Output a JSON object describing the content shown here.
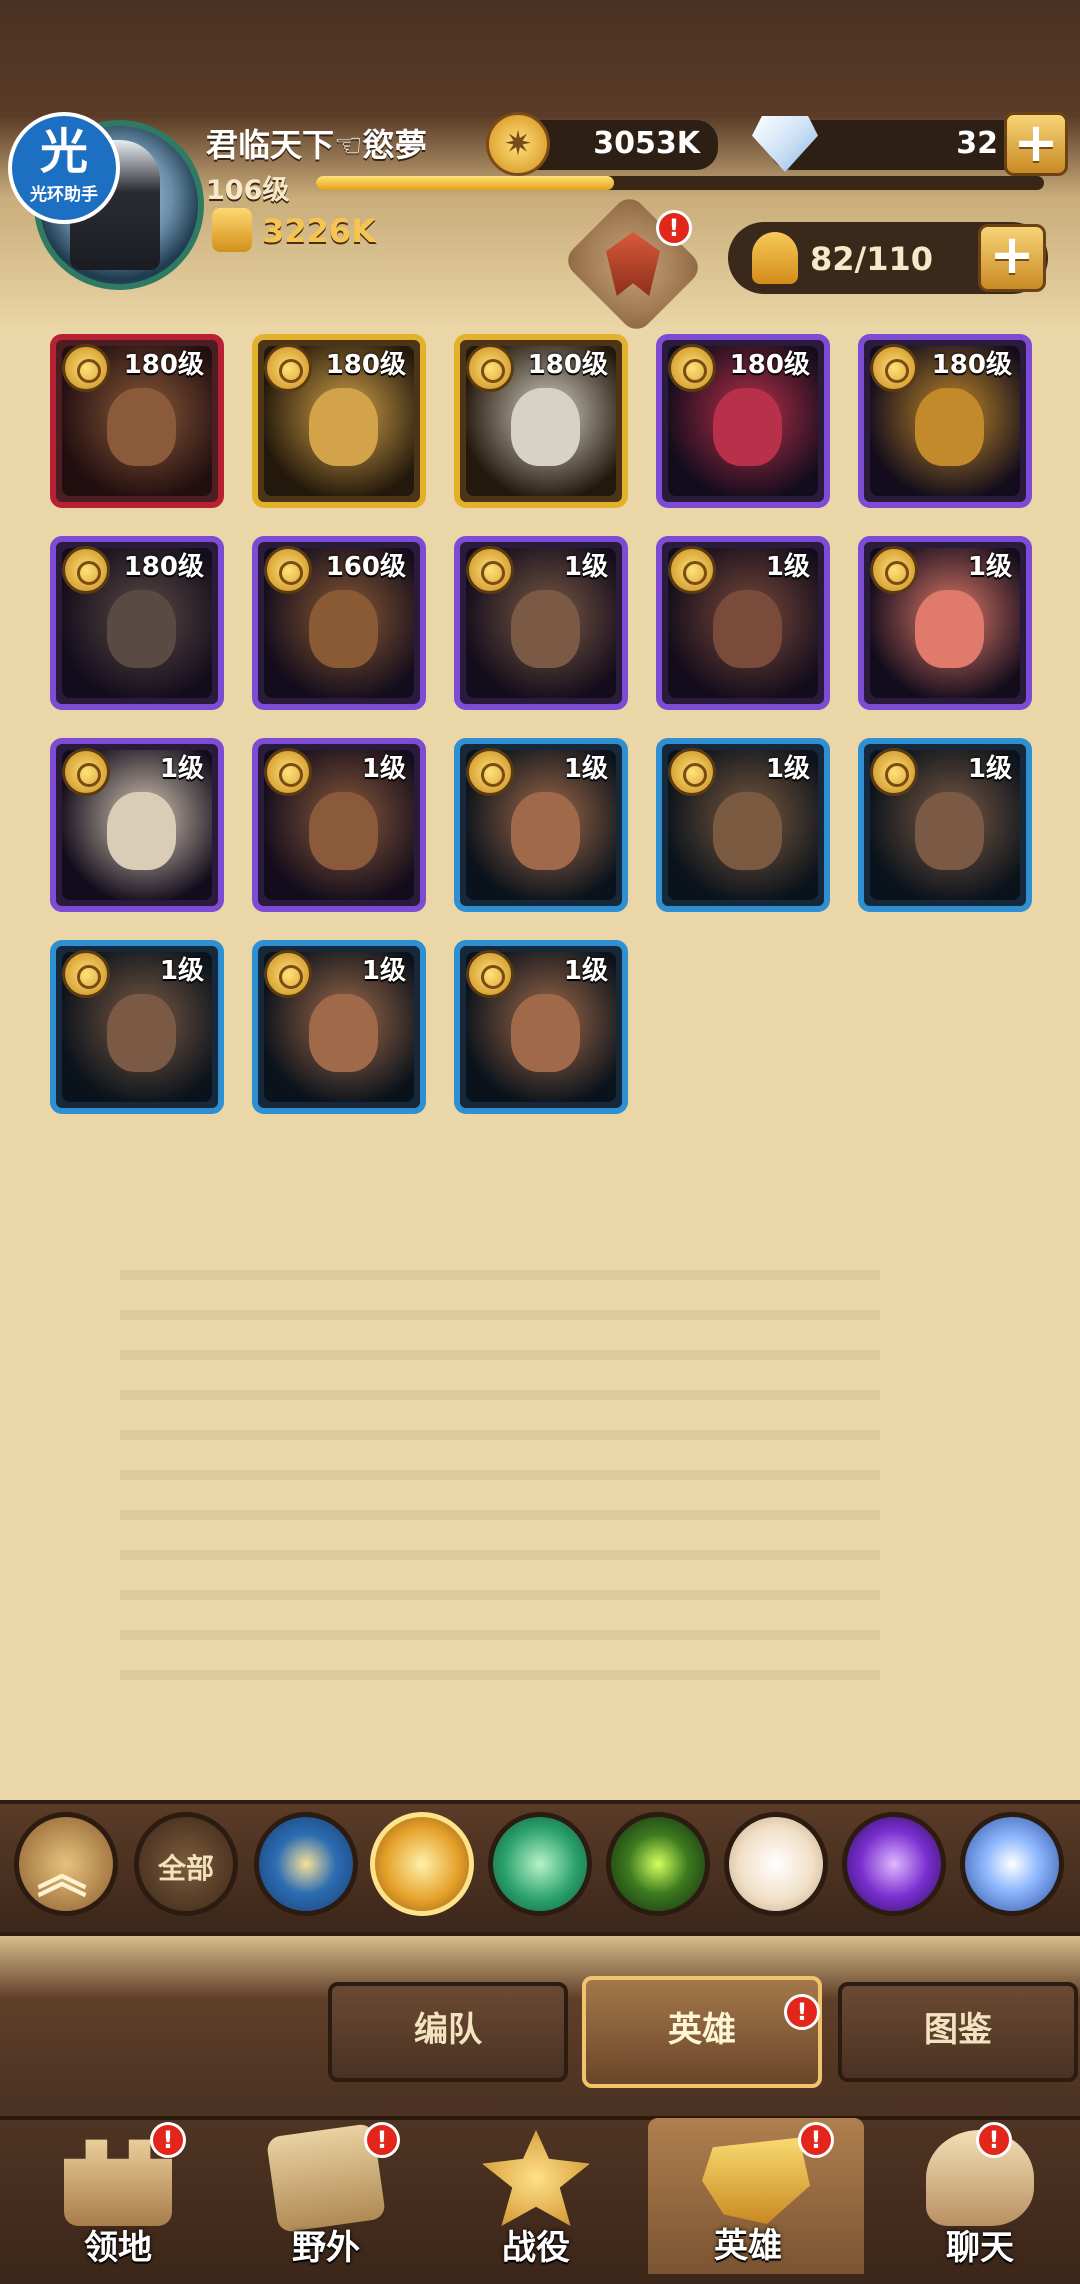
{
  "player": {
    "name": "君临天下☜慾夢",
    "level": "106级",
    "power": "3226K",
    "xp_progress": 0.41
  },
  "badge": {
    "big": "光",
    "small": "光环助手"
  },
  "currency": {
    "gold": "3053K",
    "gems": "32",
    "plus_symbol": "+"
  },
  "hero_slots": "82/110",
  "alert_symbol": "!",
  "heroes": [
    {
      "level": "180级",
      "rarity": "red",
      "color": "#8a5a3a"
    },
    {
      "level": "180级",
      "rarity": "gold",
      "color": "#d3a34a"
    },
    {
      "level": "180级",
      "rarity": "gold",
      "color": "#d6d2c4"
    },
    {
      "level": "180级",
      "rarity": "purple",
      "color": "#b8304a"
    },
    {
      "level": "180级",
      "rarity": "purple",
      "color": "#c28a2a"
    },
    {
      "level": "180级",
      "rarity": "purple",
      "color": "#5a4a44"
    },
    {
      "level": "160级",
      "rarity": "purple",
      "color": "#8a5a34"
    },
    {
      "level": "1级",
      "rarity": "purple",
      "color": "#7a5a44"
    },
    {
      "level": "1级",
      "rarity": "purple",
      "color": "#7a4a3a"
    },
    {
      "level": "1级",
      "rarity": "purple",
      "color": "#e07a6a"
    },
    {
      "level": "1级",
      "rarity": "purple",
      "color": "#d9cdb8"
    },
    {
      "level": "1级",
      "rarity": "purple",
      "color": "#8a5a3a"
    },
    {
      "level": "1级",
      "rarity": "blue",
      "color": "#a06a4a"
    },
    {
      "level": "1级",
      "rarity": "blue",
      "color": "#7a5a40"
    },
    {
      "level": "1级",
      "rarity": "blue",
      "color": "#7a5a44"
    },
    {
      "level": "1级",
      "rarity": "blue",
      "color": "#7a5a44"
    },
    {
      "level": "1级",
      "rarity": "blue",
      "color": "#a06a4a"
    },
    {
      "level": "1级",
      "rarity": "blue",
      "color": "#a06a4a"
    }
  ],
  "filter": {
    "collapse_symbol": "︽",
    "all_label": "全部",
    "selected": "gold-faction"
  },
  "subtabs": {
    "team": "编队",
    "hero": "英雄",
    "codex": "图鉴"
  },
  "nav": {
    "territory": "领地",
    "wild": "野外",
    "campaign": "战役",
    "hero": "英雄",
    "chat": "聊天",
    "active": "hero"
  }
}
